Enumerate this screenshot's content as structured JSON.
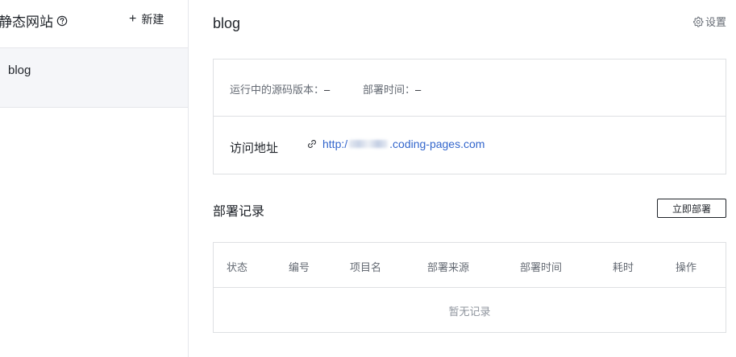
{
  "sidebar": {
    "title": "静态网站",
    "new_label": "新建",
    "items": [
      {
        "label": "blog"
      }
    ]
  },
  "main": {
    "title": "blog",
    "settings_label": "设置",
    "info": {
      "version_label": "运行中的源码版本：",
      "version_value": "–",
      "deploy_time_label": "部署时间：",
      "deploy_time_value": "–",
      "visit_label": "访问地址",
      "url_prefix": "http:/",
      "url_suffix": ".coding-pages.com"
    },
    "deploy": {
      "title": "部署记录",
      "button_label": "立即部署",
      "columns": [
        "状态",
        "编号",
        "项目名",
        "部署来源",
        "部署时间",
        "耗时",
        "操作"
      ],
      "empty_text": "暂无记录"
    }
  },
  "colors": {
    "link": "#3366cc",
    "border": "#dee0e3",
    "selected_bg": "#f5f6f9"
  }
}
